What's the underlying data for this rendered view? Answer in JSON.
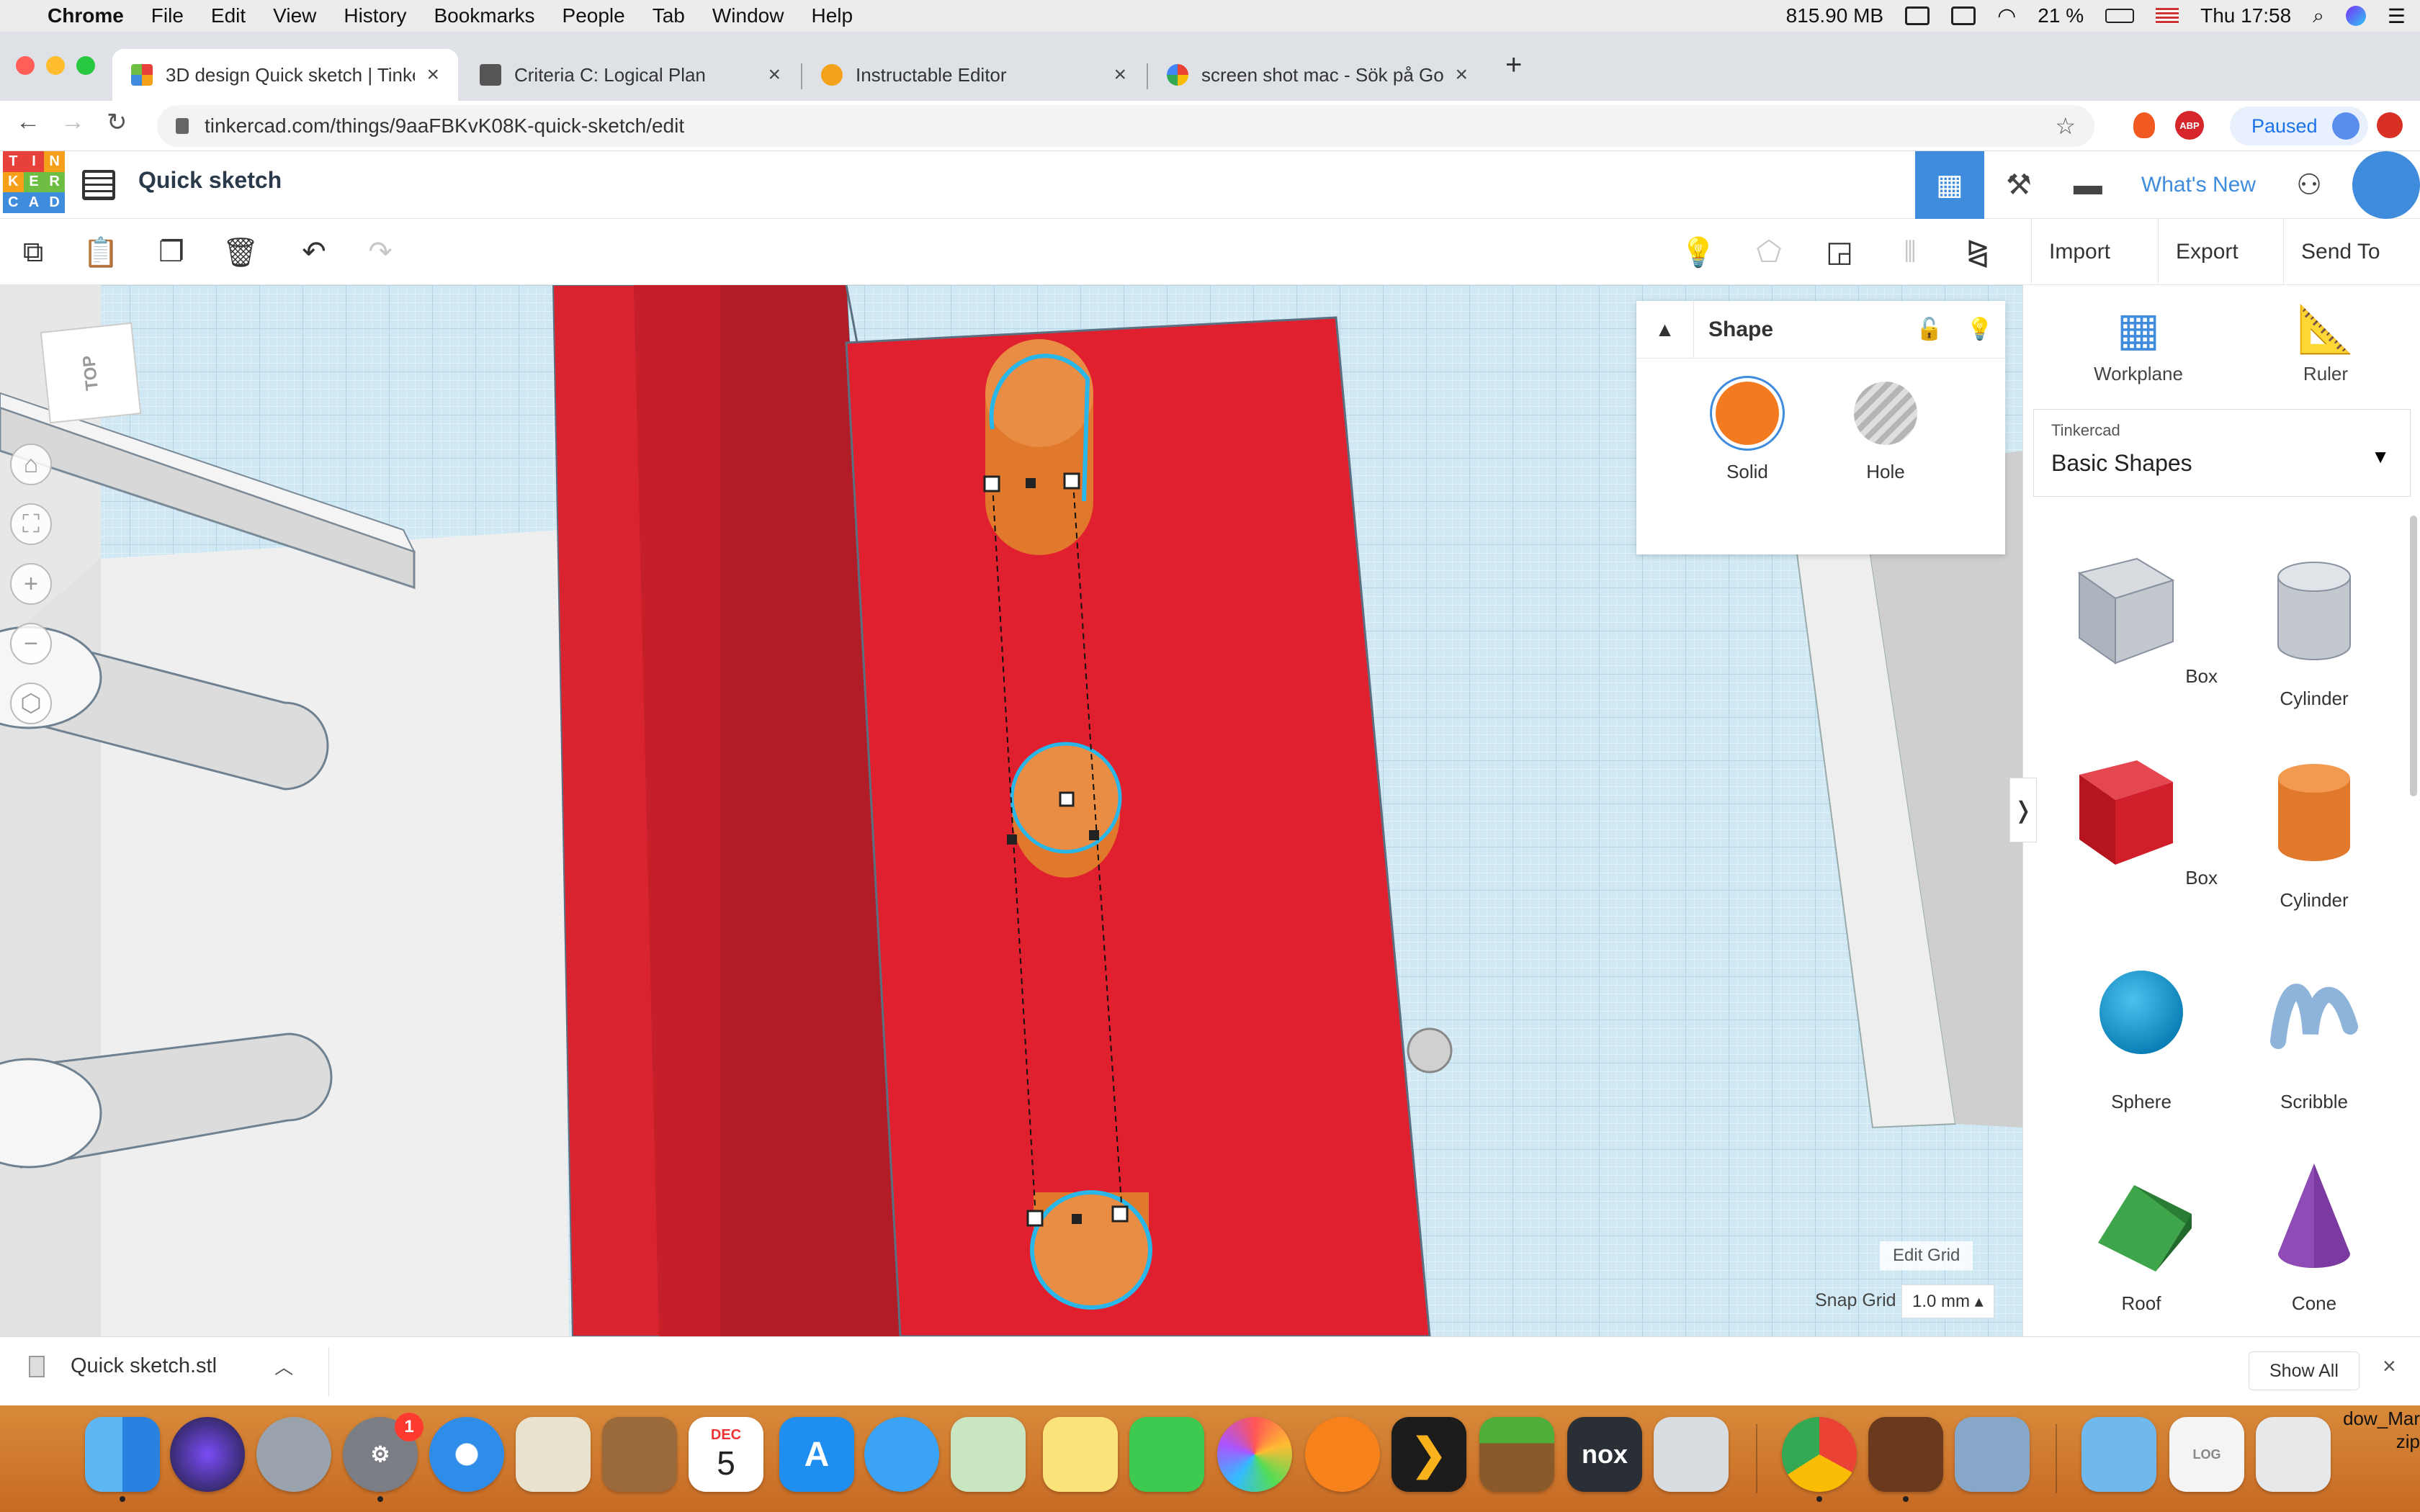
{
  "menubar": {
    "items": [
      "Chrome",
      "File",
      "Edit",
      "View",
      "History",
      "Bookmarks",
      "People",
      "Tab",
      "Window",
      "Help"
    ],
    "memory": "815.90 MB",
    "battery": "21 %",
    "clock": "Thu 17:58"
  },
  "tabs": [
    {
      "title": "3D design Quick sketch | Tinkercad",
      "close": "×"
    },
    {
      "title": "Criteria C: Logical Plan",
      "close": "×"
    },
    {
      "title": "Instructable Editor",
      "close": "×"
    },
    {
      "title": "screen shot mac - Sök på Google",
      "close": "×"
    }
  ],
  "new_tab": "+",
  "address": {
    "url": "tinkercad.com/things/9aaFBKvK08K-quick-sketch/edit",
    "paused_label": "Paused",
    "adblock": "ABP"
  },
  "app": {
    "logo_letters": [
      "T",
      "I",
      "N",
      "K",
      "E",
      "R",
      "C",
      "A",
      "D"
    ],
    "doc_title": "Quick sketch",
    "whats_new": "What's New"
  },
  "toolbar": {
    "import": "Import",
    "export": "Export",
    "send_to": "Send To"
  },
  "viewcube": {
    "face": "TOP"
  },
  "inspector": {
    "title": "Shape",
    "solid_label": "Solid",
    "hole_label": "Hole",
    "solid_color": "#f47a20"
  },
  "grid": {
    "edit_grid": "Edit Grid",
    "snap_label": "Snap Grid",
    "snap_value": "1.0 mm ▴"
  },
  "rpanel": {
    "workplane": "Workplane",
    "ruler": "Ruler",
    "library_caption": "Tinkercad",
    "library_value": "Basic Shapes",
    "shapes": [
      "Box",
      "Cylinder",
      "Box",
      "Cylinder",
      "Sphere",
      "Scribble",
      "Roof",
      "Cone"
    ]
  },
  "downloads": {
    "file": "Quick sketch.stl",
    "show_all": "Show All",
    "close": "×"
  },
  "dock": {
    "calendar_month": "DEC",
    "calendar_day": "5",
    "badge": "1",
    "zip_label_1": "dow_Mar",
    "zip_label_2": "zip"
  },
  "colors": {
    "accent": "#3f8bdc",
    "model_red": "#d9242f",
    "orange": "#f47a20",
    "selection": "#29b6e8"
  }
}
